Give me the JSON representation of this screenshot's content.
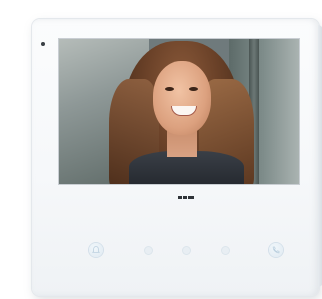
{
  "device": {
    "brand_logo": "---"
  },
  "screen": {
    "content": "video-feed"
  },
  "buttons": [
    {
      "icon": "bell-icon"
    },
    {
      "icon": "key-icon"
    },
    {
      "icon": "speaker-icon"
    },
    {
      "icon": "door-icon"
    },
    {
      "icon": "call-icon"
    }
  ],
  "colors": {
    "device_body": "#f6f8fa",
    "accent": "#dfe9f1"
  }
}
